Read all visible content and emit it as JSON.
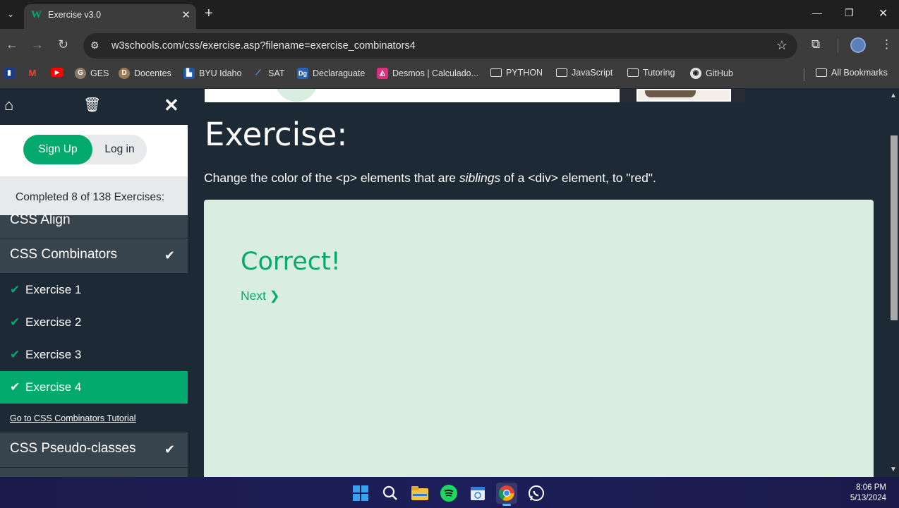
{
  "browser": {
    "tab_title": "Exercise v3.0",
    "url": "w3schools.com/css/exercise.asp?filename=exercise_combinators4",
    "bookmarks": [
      {
        "label": "",
        "icon": "bookmark-app-icon"
      },
      {
        "label": "",
        "icon": "gmail-icon"
      },
      {
        "label": "",
        "icon": "youtube-icon"
      },
      {
        "label": "GES",
        "icon": "ges-icon"
      },
      {
        "label": "Docentes",
        "icon": "docentes-icon"
      },
      {
        "label": "BYU Idaho",
        "icon": "byu-icon"
      },
      {
        "label": "SAT",
        "icon": "sat-icon"
      },
      {
        "label": "Declaraguate",
        "icon": "declaraguate-icon"
      },
      {
        "label": "Desmos | Calculado...",
        "icon": "desmos-icon"
      },
      {
        "label": "PYTHON",
        "icon": "folder-icon"
      },
      {
        "label": "JavaScript",
        "icon": "folder-icon"
      },
      {
        "label": "Tutoring",
        "icon": "folder-icon"
      },
      {
        "label": "GitHub",
        "icon": "github-icon"
      }
    ],
    "all_bookmarks": "All Bookmarks"
  },
  "sidebar": {
    "signup": "Sign Up",
    "login": "Log in",
    "progress": "Completed 8 of 138 Exercises:",
    "categories": {
      "align": "CSS Align",
      "combinators": "CSS Combinators",
      "pseudo": "CSS Pseudo-classes"
    },
    "exercises": [
      "Exercise 1",
      "Exercise 2",
      "Exercise 3",
      "Exercise 4"
    ],
    "active_exercise": "Exercise 4",
    "tutorial_link": "Go to CSS Combinators Tutorial"
  },
  "main": {
    "heading": "Exercise:",
    "instruction_pre": "Change the color of the <p> elements that are ",
    "instruction_em": "siblings",
    "instruction_post": " of a <div> element, to \"red\".",
    "result": "Correct!",
    "next": "Next ❯"
  },
  "taskbar": {
    "time": "8:06 PM",
    "date": "5/13/2024"
  },
  "colors": {
    "accent": "#04aa6d",
    "page_bg": "#1d2a35",
    "result_bg": "#d9eee1"
  }
}
